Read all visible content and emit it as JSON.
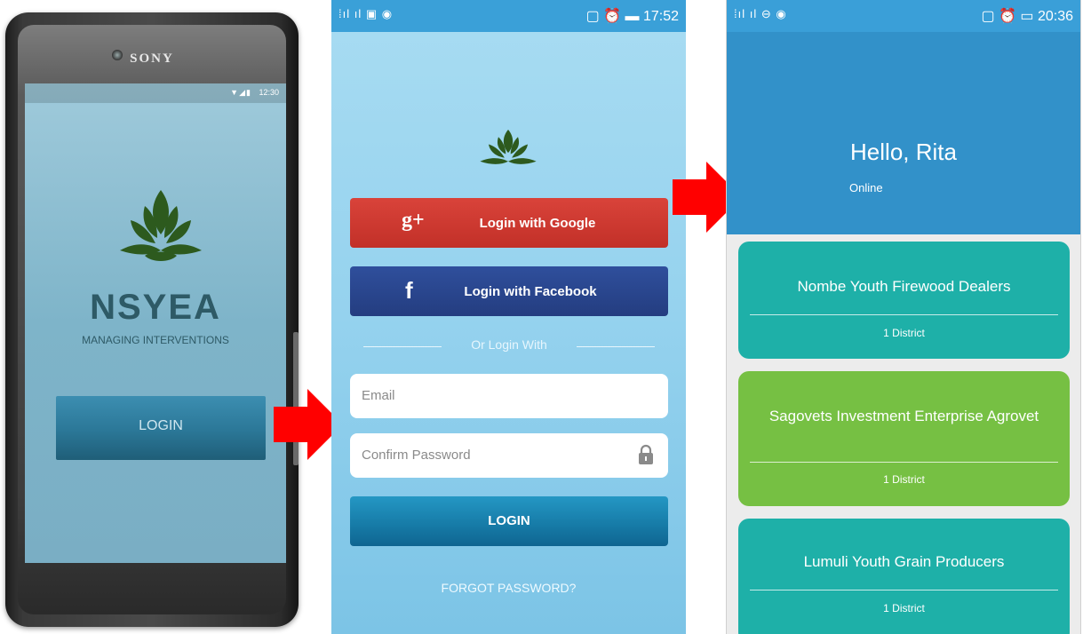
{
  "colors": {
    "teal_card": "#1eb0a8",
    "green_card": "#76c043",
    "header_blue": "#3291c9",
    "google_red": "#cc362e",
    "facebook_blue": "#29468c",
    "logo_green": "#2d5a1e",
    "arrow_red": "#ff0000"
  },
  "phone1": {
    "brand": "SONY",
    "clock": "12:30",
    "logo_icon": "lotus-logo-icon",
    "app_name": "NSYEA",
    "tagline": "MANAGING INTERVENTIONS",
    "login_label": "LOGIN"
  },
  "phone2": {
    "status_time": "17:52",
    "logo_icon": "lotus-logo-icon",
    "google_icon": "g+",
    "google_label": "Login with Google",
    "facebook_icon": "f",
    "facebook_label": "Login with Facebook",
    "or_label": "Or Login With",
    "email_placeholder": "Email",
    "password_placeholder": "Confirm Password",
    "login_label": "LOGIN",
    "forgot_label": "FORGOT PASSWORD?"
  },
  "phone3": {
    "status_time": "20:36",
    "greeting": "Hello, Rita",
    "presence": "Online",
    "groups": [
      {
        "name": "Nombe Youth Firewood Dealers",
        "district": "1 District",
        "color": "teal"
      },
      {
        "name": "Sagovets Investment Enterprise Agrovet",
        "district": "1 District",
        "color": "green"
      },
      {
        "name": "Lumuli Youth Grain Producers",
        "district": "1 District",
        "color": "teal"
      }
    ]
  }
}
